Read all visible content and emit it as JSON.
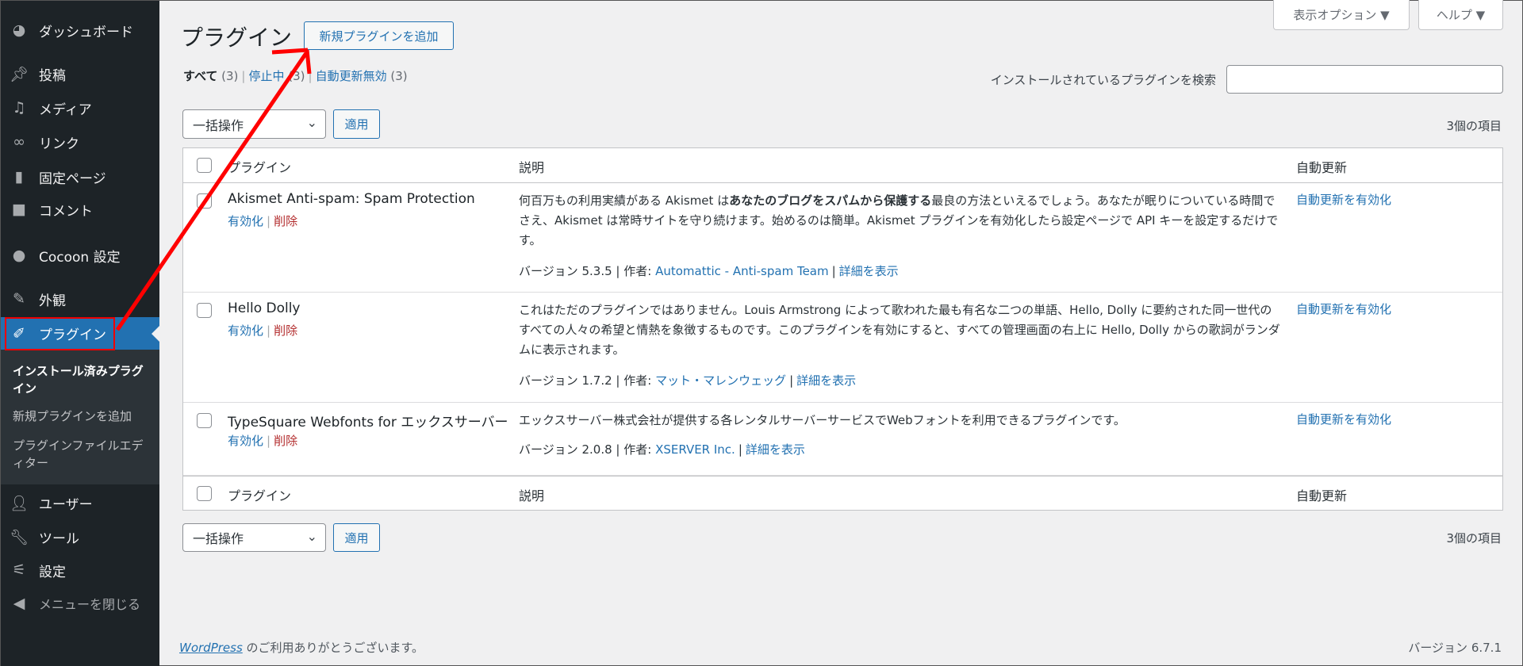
{
  "sidebar": {
    "items": [
      {
        "label": "ダッシュボード",
        "icon": "dashboard-icon"
      },
      {
        "label": "投稿",
        "icon": "pin-icon"
      },
      {
        "label": "メディア",
        "icon": "media-icon"
      },
      {
        "label": "リンク",
        "icon": "link-icon"
      },
      {
        "label": "固定ページ",
        "icon": "page-icon"
      },
      {
        "label": "コメント",
        "icon": "comment-icon"
      },
      {
        "label": "Cocoon 設定",
        "icon": "circle-icon"
      },
      {
        "label": "外観",
        "icon": "brush-icon"
      },
      {
        "label": "プラグイン",
        "icon": "plugin-icon"
      },
      {
        "label": "ユーザー",
        "icon": "user-icon"
      },
      {
        "label": "ツール",
        "icon": "wrench-icon"
      },
      {
        "label": "設定",
        "icon": "settings-icon"
      },
      {
        "label": "メニューを閉じる",
        "icon": "collapse-icon"
      }
    ],
    "submenu": [
      "インストール済みプラグイン",
      "新規プラグインを追加",
      "プラグインファイルエディター"
    ]
  },
  "header": {
    "title": "プラグイン",
    "add_new": "新規プラグインを追加",
    "screen_options": "表示オプション ▼",
    "help": "ヘルプ ▼"
  },
  "filters": {
    "all": "すべて",
    "all_count": "(3)",
    "inactive": "停止中",
    "inactive_count": "(3)",
    "auto_disabled": "自動更新無効",
    "auto_disabled_count": "(3)"
  },
  "search": {
    "label": "インストールされているプラグインを検索",
    "value": ""
  },
  "bulk": {
    "select": "一括操作",
    "apply": "適用",
    "count": "3個の項目"
  },
  "table": {
    "headers": [
      "プラグイン",
      "説明",
      "自動更新"
    ],
    "rows": [
      {
        "name": "Akismet Anti-spam: Spam Protection",
        "activate": "有効化",
        "delete": "削除",
        "desc_a": "何百万もの利用実績がある Akismet は",
        "desc_bold": "あなたのブログをスパムから保護する",
        "desc_b": "最良の方法といえるでしょう。あなたが眠りについている時間でさえ、Akismet は常時サイトを守り続けます。始めるのは簡単。Akismet プラグインを有効化したら設定ページで API キーを設定するだけです。",
        "version": "バージョン 5.3.5 | 作者: ",
        "author": "Automattic - Anti-spam Team",
        "details": "詳細を表示",
        "auto": "自動更新を有効化"
      },
      {
        "name": "Hello Dolly",
        "activate": "有効化",
        "delete": "削除",
        "desc": "これはただのプラグインではありません。Louis Armstrong によって歌われた最も有名な二つの単語、Hello, Dolly に要約された同一世代のすべての人々の希望と情熱を象徴するものです。このプラグインを有効にすると、すべての管理画面の右上に Hello, Dolly からの歌詞がランダムに表示されます。",
        "version": "バージョン 1.7.2 | 作者: ",
        "author": "マット・マレンウェッグ",
        "details": "詳細を表示",
        "auto": "自動更新を有効化"
      },
      {
        "name": "TypeSquare Webfonts for エックスサーバー",
        "activate": "有効化",
        "delete": "削除",
        "desc": "エックスサーバー株式会社が提供する各レンタルサーバーサービスでWebフォントを利用できるプラグインです。",
        "version": "バージョン 2.0.8 | 作者: ",
        "author": "XSERVER Inc.",
        "details": "詳細を表示",
        "auto": "自動更新を有効化"
      }
    ]
  },
  "footer": {
    "wp": "WordPress",
    "thanks": " のご利用ありがとうございます。",
    "version": "バージョン 6.7.1"
  },
  "colors": {
    "accent": "#2271b1",
    "sidebar": "#1d2327",
    "annotation": "#ff0000",
    "delete": "#b32d2e"
  }
}
